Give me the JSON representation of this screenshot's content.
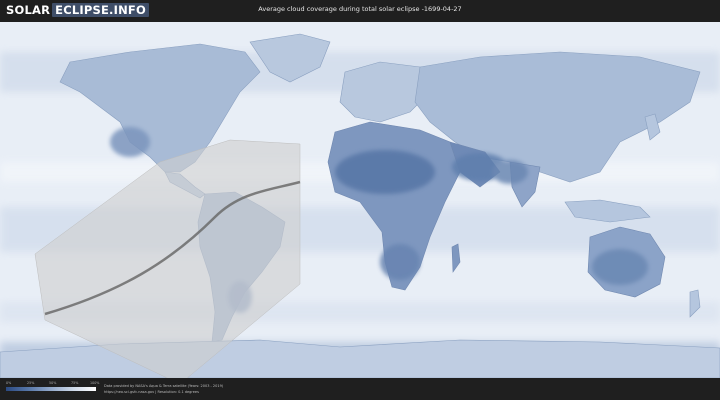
{
  "header": {
    "logo_part1": "SOLAR",
    "logo_part2": "ECLIPSE.INFO",
    "title": "Average cloud coverage during total solar eclipse -1699-04-27"
  },
  "legend": {
    "ticks": [
      "0%",
      "25%",
      "50%",
      "75%",
      "100%"
    ],
    "gradient_colors": [
      "#2b4a82",
      "#5777a8",
      "#94aacb",
      "#cfdaea",
      "#ffffff"
    ]
  },
  "footer": {
    "credit_line1": "Data provided by NASA's Aqua & Terra satellite (Years: 2003 - 2019)",
    "credit_line2": "https://neo.sci.gsfc.nasa.gov   |   Resolution: 0.1 degrees"
  },
  "map": {
    "ocean_color": "#eaf0f7",
    "cloudy_land_color": "#e4ebf4",
    "clear_land_color": "#5b7aa8",
    "eclipse_band_color": "#c8c8c8",
    "central_line_color": "#6b6b6b"
  }
}
